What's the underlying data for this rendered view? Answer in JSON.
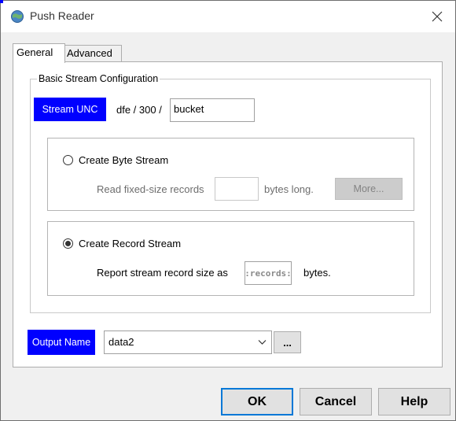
{
  "window": {
    "title": "Push Reader",
    "app_icon": "gear-globe-icon",
    "close_icon": "close-icon"
  },
  "tabs": [
    {
      "label": "General",
      "active": true
    },
    {
      "label": "Advanced",
      "active": false
    }
  ],
  "basic_stream": {
    "group_title": "Basic Stream Configuration",
    "stream_unc_label": "Stream UNC",
    "path_prefix": "dfe / 300 /",
    "bucket_value": "bucket"
  },
  "byte_stream": {
    "radio_label": "Create Byte Stream",
    "selected": false,
    "read_fixed_label": "Read fixed-size records",
    "fixed_size_value": "",
    "bytes_long_label": "bytes long.",
    "more_label": "More..."
  },
  "record_stream": {
    "radio_label": "Create Record Stream",
    "selected": true,
    "report_label": "Report stream record size as",
    "record_size_value": ":records:",
    "bytes_label": "bytes."
  },
  "output": {
    "label": "Output Name",
    "value": "data2",
    "browse_label": "..."
  },
  "buttons": {
    "ok": "OK",
    "cancel": "Cancel",
    "help": "Help"
  },
  "colors": {
    "label_bg": "#0000ff",
    "default_button_border": "#0078d7"
  }
}
